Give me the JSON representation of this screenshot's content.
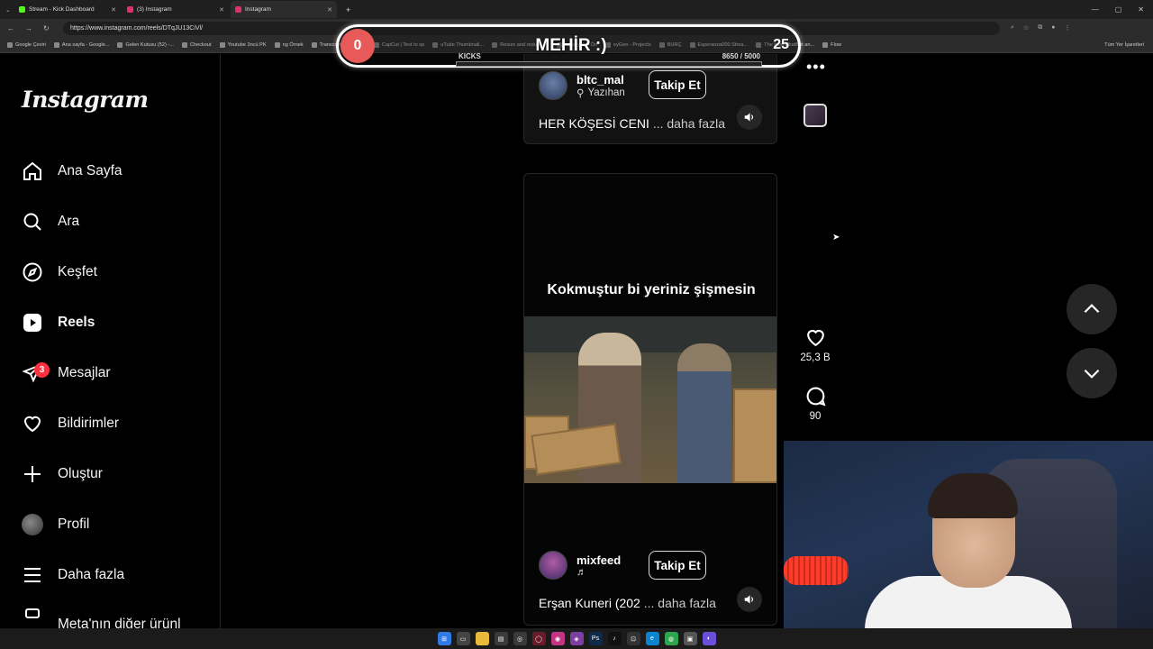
{
  "browser": {
    "tabs": [
      {
        "label": "Stream - Kick Dashboard",
        "color": "#53fc18",
        "active": false
      },
      {
        "label": "(3) Instagram",
        "color": "#e1306c",
        "active": false
      },
      {
        "label": "Instagram",
        "color": "#e1306c",
        "active": true
      }
    ],
    "url": "https://www.instagram.com/reels/DTqJU13CiVl/",
    "bookmarks": [
      "Google Çeviri",
      "Ana sayfa - Google...",
      "Gelen Kutusu (52) -...",
      "Checkout",
      "Youtube 3ncü PK",
      "ng Örnek",
      "Transcript of \"Mi M...",
      "CapCut | Text to sp",
      "uTube Thumbnail...",
      "Resize and reduce i...",
      "İspanyolca Ön",
      "eyGen - Projects",
      "BURÇ",
      "Esperanza000 Strea...",
      "The best ChatBot an...",
      "Flow"
    ],
    "bookmarks_right": "Tüm Yer İşaretleri"
  },
  "overlay": {
    "left_value": "0",
    "title": "MEHİR :)",
    "right_value": "25",
    "kicks_label": "KICKS",
    "kicks_count": "8650  / 5000"
  },
  "sidebar": {
    "logo": "Instagram",
    "items": [
      {
        "label": "Ana Sayfa",
        "icon": "home-icon"
      },
      {
        "label": "Ara",
        "icon": "search-icon"
      },
      {
        "label": "Keşfet",
        "icon": "compass-icon"
      },
      {
        "label": "Reels",
        "icon": "reels-icon"
      },
      {
        "label": "Mesajlar",
        "icon": "messenger-icon"
      },
      {
        "label": "Bildirimler",
        "icon": "heart-icon"
      },
      {
        "label": "Oluştur",
        "icon": "plus-icon"
      },
      {
        "label": "Profil",
        "icon": "avatar"
      },
      {
        "label": "Daha fazla",
        "icon": "menu-icon"
      },
      {
        "label": "Meta'nın diğer ürünl",
        "icon": "meta-icon"
      }
    ],
    "messages_badge": "3"
  },
  "reel_top": {
    "username": "bltc_mal",
    "location": "Yazıhan",
    "follow_label": "Takip Et",
    "caption": "HER KÖŞESİ CENI",
    "more": "... daha fazla"
  },
  "reel_main": {
    "overlay_text": "Kokmuştur bi yeriniz şişmesin",
    "username": "mixfeed",
    "audio_symbol": "♬",
    "follow_label": "Takip Et",
    "caption": "Erşan Kuneri (202",
    "more": "... daha fazla",
    "likes": "25,3 B",
    "comments": "90"
  },
  "actions": {
    "more_dots": "•••"
  }
}
